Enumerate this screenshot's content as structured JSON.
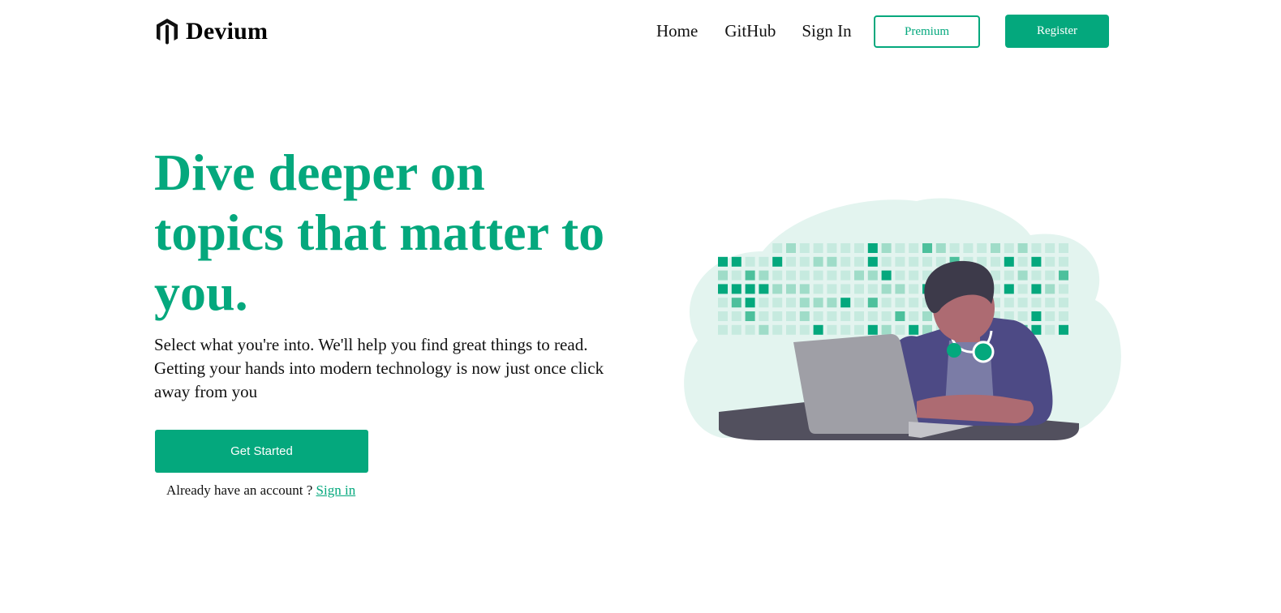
{
  "brand": {
    "name": "Devium",
    "icon": "magento-hexagon-logo"
  },
  "nav": {
    "links": [
      "Home",
      "GitHub",
      "Sign In"
    ],
    "premium_label": "Premium",
    "register_label": "Register"
  },
  "hero": {
    "title": "Dive deeper on topics that matter to you.",
    "description": "Select what you're into. We'll help you find great things to read. Getting your hands into modern technology is now just once click away from you",
    "cta_label": "Get Started",
    "signin_prompt": "Already have an account ? ",
    "signin_link": "Sign in"
  },
  "illustration": {
    "subject": "person-using-laptop-illustration"
  },
  "colors": {
    "accent": "#04a87d",
    "accent_light": "#e3f4ef",
    "text": "#111111"
  }
}
